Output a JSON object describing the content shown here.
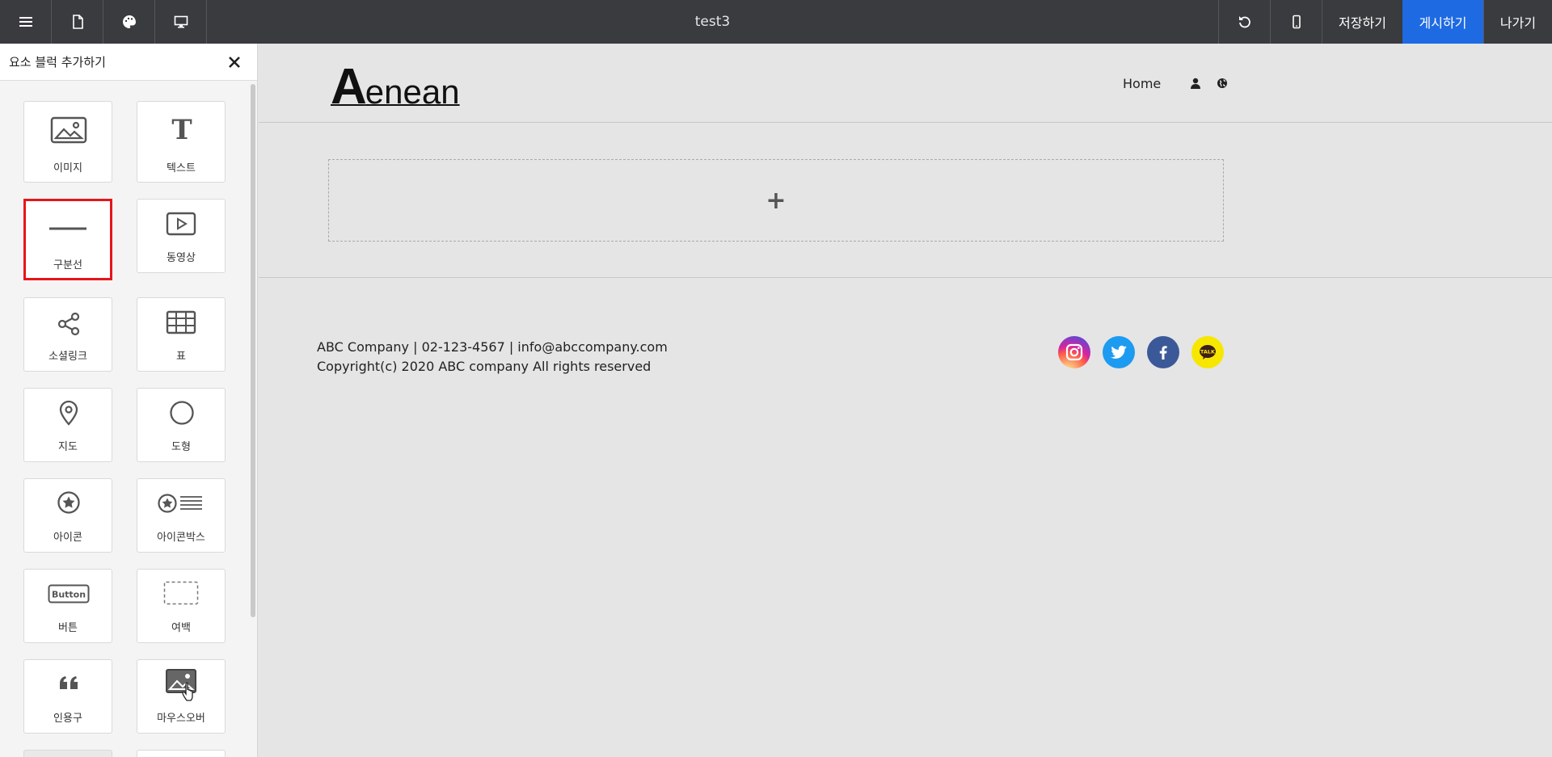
{
  "topbar": {
    "title": "test3",
    "save_label": "저장하기",
    "publish_label": "게시하기",
    "exit_label": "나가기",
    "publish_color": "#1e6ae3"
  },
  "sidebar": {
    "title": "요소 블럭 추가하기",
    "tiles": [
      {
        "label": "이미지",
        "icon": "image-icon"
      },
      {
        "label": "텍스트",
        "icon": "text-icon"
      },
      {
        "label": "구분선",
        "icon": "divider-icon",
        "selected": true
      },
      {
        "label": "동영상",
        "icon": "video-icon"
      },
      {
        "label": "소셜링크",
        "icon": "share-icon"
      },
      {
        "label": "표",
        "icon": "table-icon"
      },
      {
        "label": "지도",
        "icon": "map-pin-icon"
      },
      {
        "label": "도형",
        "icon": "circle-icon"
      },
      {
        "label": "아이콘",
        "icon": "star-circle-icon"
      },
      {
        "label": "아이콘박스",
        "icon": "icon-box-icon"
      },
      {
        "label": "버튼",
        "icon": "button-icon",
        "icon_text": "Button"
      },
      {
        "label": "여백",
        "icon": "spacer-icon"
      },
      {
        "label": "인용구",
        "icon": "quote-icon"
      },
      {
        "label": "마우스오버",
        "icon": "mouseover-icon"
      }
    ],
    "selection_color": "#e8141b"
  },
  "site": {
    "logo_big": "A",
    "logo_rest": "enean",
    "nav_home": "Home",
    "add_symbol": "+",
    "footer_line1": "ABC Company | 02-123-4567 | info@abccompany.com",
    "footer_line2": "Copyright(c) 2020 ABC company All rights reserved",
    "social": [
      {
        "name": "instagram-icon",
        "color": "#c13584"
      },
      {
        "name": "twitter-icon",
        "color": "#1d9bf0"
      },
      {
        "name": "facebook-icon",
        "color": "#3b5998"
      },
      {
        "name": "kakaotalk-icon",
        "color": "#f7e600",
        "text": "TALK"
      }
    ]
  }
}
